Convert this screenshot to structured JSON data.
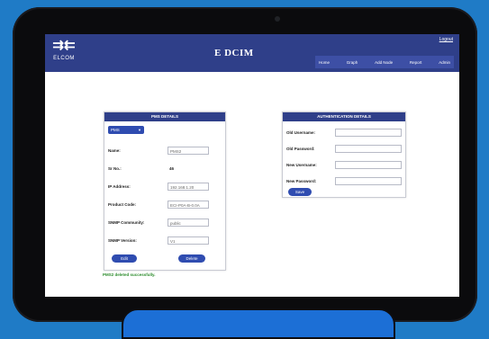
{
  "app": {
    "title": "E DCIM",
    "logo_text": "ELCOM",
    "logout": "Logout"
  },
  "nav": [
    "Home",
    "Graph",
    "Add Node",
    "Report",
    "Admin"
  ],
  "pms_details": {
    "header": "PMS DETAILS",
    "select_value": "PMS",
    "name_label": "Name:",
    "name_value": "PMS2",
    "sr_label": "Sr No.:",
    "sr_value": "46",
    "ip_label": "IP Address:",
    "ip_value": "192.168.1.20",
    "product_label": "Product Code:",
    "product_value": "ECI-P0A-B-0.0A",
    "community_label": "SNMP Community:",
    "community_value": "public",
    "version_label": "SNMP Version:",
    "version_value": "V1",
    "edit": "Edit",
    "delete": "Delete"
  },
  "message": "PMS2 deleted successfully.",
  "auth": {
    "header": "AUTHENTICATION DETAILS",
    "old_user": "Old Username:",
    "old_pass": "Old Password:",
    "new_user": "New Username:",
    "new_pass": "New Password:",
    "save": "Save"
  }
}
